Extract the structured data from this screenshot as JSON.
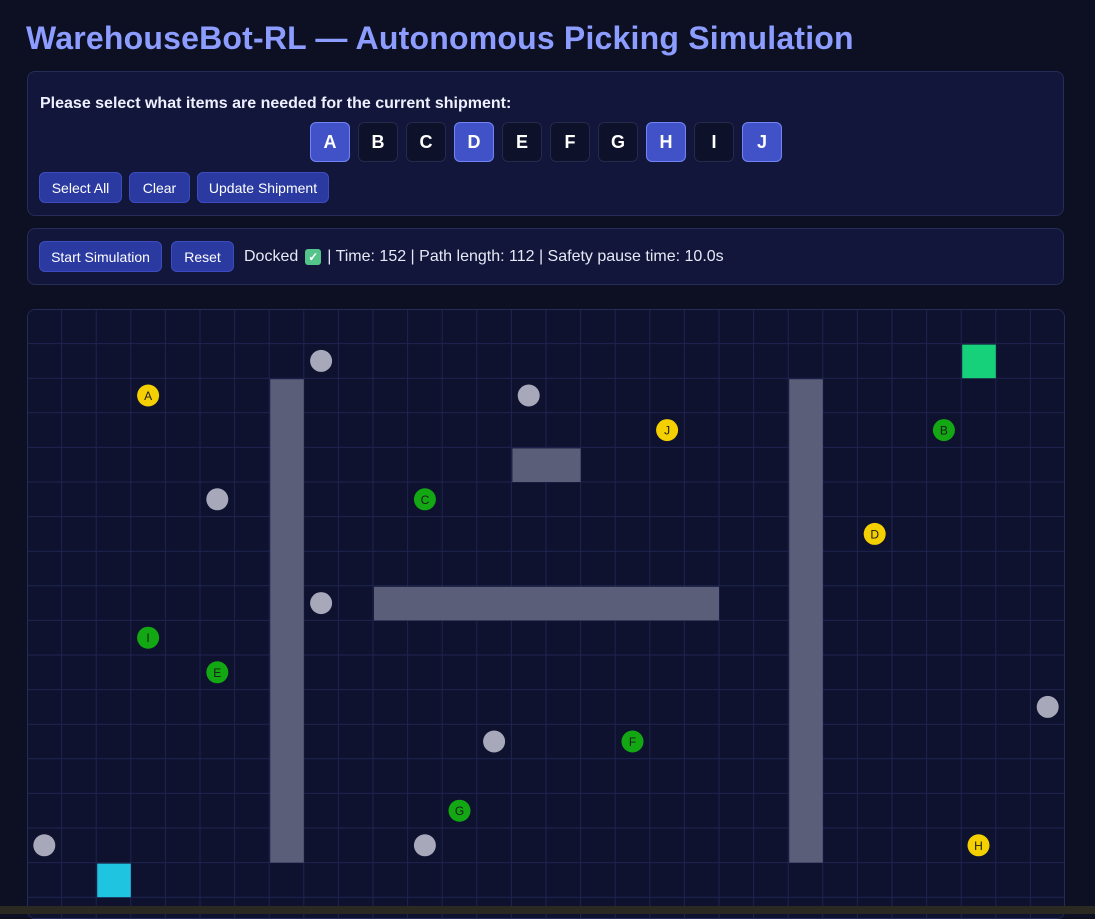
{
  "title": "WarehouseBot-RL — Autonomous Picking Simulation",
  "shipment": {
    "prompt": "Please select what items are needed for the current shipment:",
    "items": [
      {
        "label": "A",
        "selected": true
      },
      {
        "label": "B",
        "selected": false
      },
      {
        "label": "C",
        "selected": false
      },
      {
        "label": "D",
        "selected": true
      },
      {
        "label": "E",
        "selected": false
      },
      {
        "label": "F",
        "selected": false
      },
      {
        "label": "G",
        "selected": false
      },
      {
        "label": "H",
        "selected": true
      },
      {
        "label": "I",
        "selected": false
      },
      {
        "label": "J",
        "selected": true
      }
    ],
    "select_all_label": "Select All",
    "clear_label": "Clear",
    "update_label": "Update Shipment"
  },
  "simulation": {
    "start_label": "Start Simulation",
    "reset_label": "Reset",
    "status_prefix": "Docked",
    "status_suffix": "| Time: 152 | Path length: 112 | Safety pause time: 10.0s"
  },
  "colors": {
    "item_needed": "#f5d000",
    "item_other": "#13a813",
    "obstacle": "#a7a9bb",
    "shelf": "#5a5e78",
    "goal": "#16d07a",
    "robot": "#1ec4e0"
  },
  "grid": {
    "cols": 30,
    "rows": 17,
    "shelves": [
      {
        "col": 7,
        "row": 2,
        "w": 1,
        "h": 14
      },
      {
        "col": 22,
        "row": 2,
        "w": 1,
        "h": 14
      },
      {
        "col": 14,
        "row": 4,
        "w": 2,
        "h": 1
      },
      {
        "col": 10,
        "row": 8,
        "w": 10,
        "h": 1
      }
    ],
    "goal": {
      "col": 27,
      "row": 1
    },
    "robot": {
      "col": 2,
      "row": 16
    },
    "obstacles": [
      {
        "col": 8,
        "row": 1
      },
      {
        "col": 14,
        "row": 2
      },
      {
        "col": 5,
        "row": 5
      },
      {
        "col": 8,
        "row": 8
      },
      {
        "col": 29,
        "row": 11
      },
      {
        "col": 13,
        "row": 12
      },
      {
        "col": 0,
        "row": 15
      },
      {
        "col": 11,
        "row": 15
      }
    ],
    "items": [
      {
        "label": "A",
        "col": 3,
        "row": 2,
        "needed": true
      },
      {
        "label": "J",
        "col": 18,
        "row": 3,
        "needed": true
      },
      {
        "label": "B",
        "col": 26,
        "row": 3,
        "needed": false
      },
      {
        "label": "C",
        "col": 11,
        "row": 5,
        "needed": false
      },
      {
        "label": "D",
        "col": 24,
        "row": 6,
        "needed": true
      },
      {
        "label": "I",
        "col": 3,
        "row": 9,
        "needed": false
      },
      {
        "label": "E",
        "col": 5,
        "row": 10,
        "needed": false
      },
      {
        "label": "F",
        "col": 17,
        "row": 12,
        "needed": false
      },
      {
        "label": "G",
        "col": 12,
        "row": 14,
        "needed": false
      },
      {
        "label": "H",
        "col": 27,
        "row": 15,
        "needed": true
      }
    ]
  }
}
